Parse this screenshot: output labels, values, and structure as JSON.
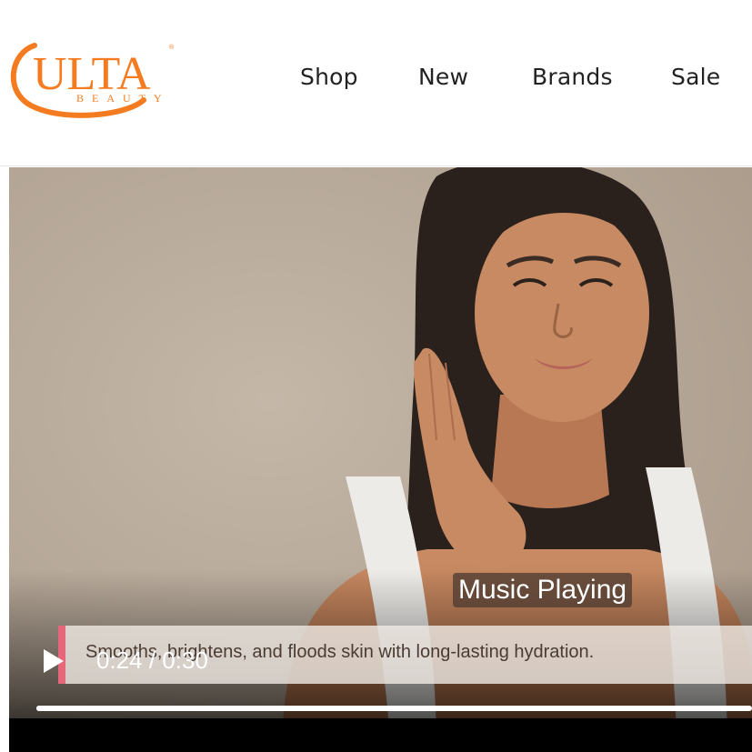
{
  "brand": {
    "name": "ULTA",
    "sub": "BEAUTY",
    "color": "#f47b20"
  },
  "nav": {
    "items": [
      {
        "label": "Shop"
      },
      {
        "label": "New"
      },
      {
        "label": "Brands"
      },
      {
        "label": "Sale"
      }
    ]
  },
  "video": {
    "caption_chip": "Music Playing",
    "subtitle_text": "Smooths, brightens, and floods skin with long-lasting hydration.",
    "current_time": "0:24",
    "duration": "0:30",
    "time_display": "0:24 / 0:30",
    "progress_fraction": 0.8,
    "play_icon": "play-icon",
    "accent": "#e6677a"
  }
}
